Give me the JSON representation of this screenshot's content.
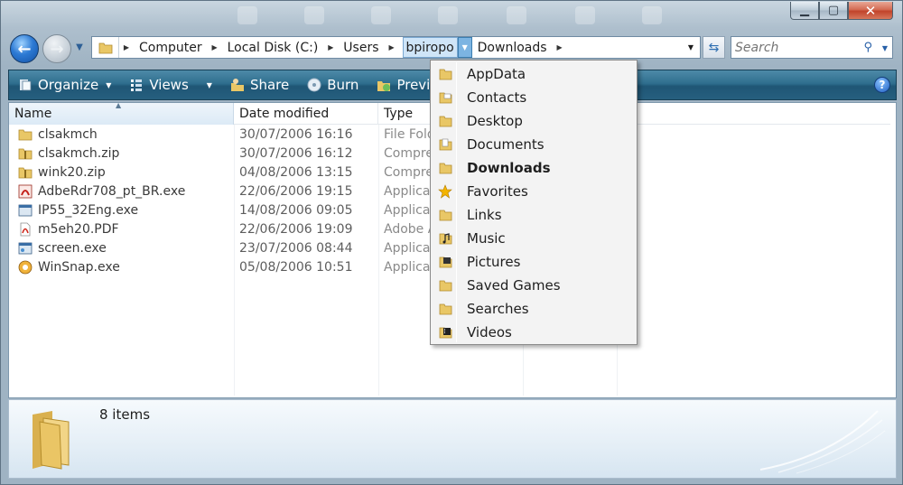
{
  "nav": {
    "breadcrumbs": [
      "Computer",
      "Local Disk (C:)",
      "Users",
      "bpiropo",
      "Downloads"
    ],
    "search_placeholder": "Search"
  },
  "toolbar": {
    "organize": "Organize",
    "views": "Views",
    "share": "Share",
    "burn": "Burn",
    "previous_versions": "Previous versions"
  },
  "columns": {
    "name": "Name",
    "date": "Date modified",
    "type": "Type"
  },
  "files": [
    {
      "name": "clsakmch",
      "date": "30/07/2006 16:16",
      "type": "File Folder",
      "icon": "folder-icon"
    },
    {
      "name": "clsakmch.zip",
      "date": "30/07/2006 16:12",
      "type": "Compressed",
      "icon": "zip-folder-icon"
    },
    {
      "name": "wink20.zip",
      "date": "04/08/2006 13:15",
      "type": "Compressed",
      "icon": "zip-folder-icon"
    },
    {
      "name": "AdbeRdr708_pt_BR.exe",
      "date": "22/06/2006 19:15",
      "type": "Application",
      "icon": "adobe-installer-icon"
    },
    {
      "name": "IP55_32Eng.exe",
      "date": "14/08/2006 09:05",
      "type": "Application",
      "icon": "exe-icon"
    },
    {
      "name": "m5eh20.PDF",
      "date": "22/06/2006 19:09",
      "type": "Adobe Acrobat",
      "icon": "pdf-icon"
    },
    {
      "name": "screen.exe",
      "date": "23/07/2006 08:44",
      "type": "Application",
      "icon": "exe-icon"
    },
    {
      "name": "WinSnap.exe",
      "date": "05/08/2006 10:51",
      "type": "Application",
      "icon": "winsnap-icon"
    }
  ],
  "status": {
    "item_count": "8 items"
  },
  "menu": {
    "items": [
      {
        "label": "AppData",
        "icon": "folder-icon"
      },
      {
        "label": "Contacts",
        "icon": "contacts-folder-icon"
      },
      {
        "label": "Desktop",
        "icon": "folder-icon"
      },
      {
        "label": "Documents",
        "icon": "documents-folder-icon"
      },
      {
        "label": "Downloads",
        "icon": "folder-icon",
        "current": true
      },
      {
        "label": "Favorites",
        "icon": "star-icon"
      },
      {
        "label": "Links",
        "icon": "folder-icon"
      },
      {
        "label": "Music",
        "icon": "music-folder-icon"
      },
      {
        "label": "Pictures",
        "icon": "pictures-folder-icon"
      },
      {
        "label": "Saved Games",
        "icon": "folder-icon"
      },
      {
        "label": "Searches",
        "icon": "folder-icon"
      },
      {
        "label": "Videos",
        "icon": "videos-folder-icon"
      }
    ]
  },
  "colors": {
    "accent": "#2f6e8e",
    "folder": "#e9c766",
    "selection": "#cfe5f8"
  }
}
